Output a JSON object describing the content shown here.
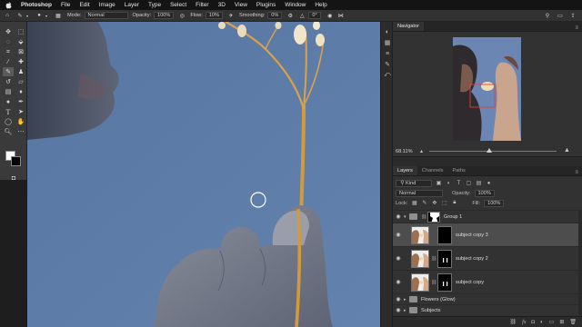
{
  "menubar": {
    "apple": "",
    "app": "Photoshop",
    "menus": [
      "File",
      "Edit",
      "Image",
      "Layer",
      "Type",
      "Select",
      "Filter",
      "3D",
      "View",
      "Plugins",
      "Window",
      "Help"
    ]
  },
  "options": {
    "mode_label": "Mode:",
    "mode_value": "Normal",
    "opacity_label": "Opacity:",
    "opacity_value": "100%",
    "flow_label": "Flow:",
    "flow_value": "10%",
    "smoothing_label": "Smoothing:",
    "smoothing_value": "0%",
    "angle_value": "0°"
  },
  "navigator": {
    "tabs": [
      "Navigator"
    ],
    "zoom": "68.11%"
  },
  "layers": {
    "tabs": [
      "Layers",
      "Channels",
      "Paths"
    ],
    "filter_label": "Kind",
    "blend_mode": "Normal",
    "opacity_label": "Opacity:",
    "opacity_value": "100%",
    "lock_label": "Lock:",
    "fill_label": "Fill:",
    "fill_value": "100%",
    "items": [
      {
        "name": "Group 1",
        "type": "group"
      },
      {
        "name": "subject copy 3",
        "type": "layer",
        "selected": true
      },
      {
        "name": "subject copy 2",
        "type": "layer",
        "selected": false
      },
      {
        "name": "subject copy",
        "type": "layer",
        "selected": false
      },
      {
        "name": "Flowers (Glow)",
        "type": "folder"
      },
      {
        "name": "Subjects",
        "type": "folder"
      }
    ]
  },
  "colors": {
    "canvas_bg": "#5a79a6",
    "panel_bg": "#323232",
    "selected_row": "#4d4d4d",
    "stem": "#d39a3a"
  },
  "icons": {
    "brush_tool": "brush-icon",
    "zoom_tool": "zoom-icon",
    "hand_tool": "hand-icon",
    "visibility": "eye-icon"
  }
}
